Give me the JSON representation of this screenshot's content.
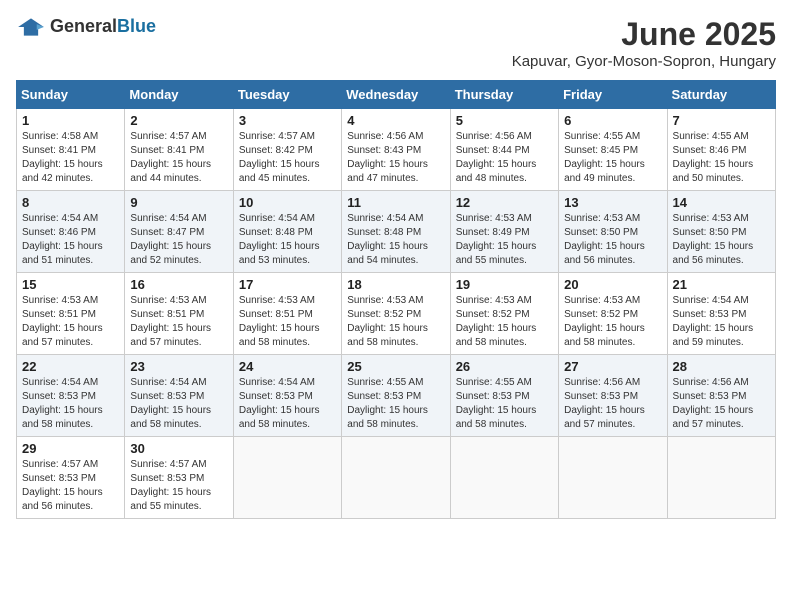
{
  "header": {
    "logo_general": "General",
    "logo_blue": "Blue",
    "month_title": "June 2025",
    "location": "Kapuvar, Gyor-Moson-Sopron, Hungary"
  },
  "days_of_week": [
    "Sunday",
    "Monday",
    "Tuesday",
    "Wednesday",
    "Thursday",
    "Friday",
    "Saturday"
  ],
  "weeks": [
    [
      {
        "day": "1",
        "sunrise": "Sunrise: 4:58 AM",
        "sunset": "Sunset: 8:41 PM",
        "daylight": "Daylight: 15 hours and 42 minutes."
      },
      {
        "day": "2",
        "sunrise": "Sunrise: 4:57 AM",
        "sunset": "Sunset: 8:41 PM",
        "daylight": "Daylight: 15 hours and 44 minutes."
      },
      {
        "day": "3",
        "sunrise": "Sunrise: 4:57 AM",
        "sunset": "Sunset: 8:42 PM",
        "daylight": "Daylight: 15 hours and 45 minutes."
      },
      {
        "day": "4",
        "sunrise": "Sunrise: 4:56 AM",
        "sunset": "Sunset: 8:43 PM",
        "daylight": "Daylight: 15 hours and 47 minutes."
      },
      {
        "day": "5",
        "sunrise": "Sunrise: 4:56 AM",
        "sunset": "Sunset: 8:44 PM",
        "daylight": "Daylight: 15 hours and 48 minutes."
      },
      {
        "day": "6",
        "sunrise": "Sunrise: 4:55 AM",
        "sunset": "Sunset: 8:45 PM",
        "daylight": "Daylight: 15 hours and 49 minutes."
      },
      {
        "day": "7",
        "sunrise": "Sunrise: 4:55 AM",
        "sunset": "Sunset: 8:46 PM",
        "daylight": "Daylight: 15 hours and 50 minutes."
      }
    ],
    [
      {
        "day": "8",
        "sunrise": "Sunrise: 4:54 AM",
        "sunset": "Sunset: 8:46 PM",
        "daylight": "Daylight: 15 hours and 51 minutes."
      },
      {
        "day": "9",
        "sunrise": "Sunrise: 4:54 AM",
        "sunset": "Sunset: 8:47 PM",
        "daylight": "Daylight: 15 hours and 52 minutes."
      },
      {
        "day": "10",
        "sunrise": "Sunrise: 4:54 AM",
        "sunset": "Sunset: 8:48 PM",
        "daylight": "Daylight: 15 hours and 53 minutes."
      },
      {
        "day": "11",
        "sunrise": "Sunrise: 4:54 AM",
        "sunset": "Sunset: 8:48 PM",
        "daylight": "Daylight: 15 hours and 54 minutes."
      },
      {
        "day": "12",
        "sunrise": "Sunrise: 4:53 AM",
        "sunset": "Sunset: 8:49 PM",
        "daylight": "Daylight: 15 hours and 55 minutes."
      },
      {
        "day": "13",
        "sunrise": "Sunrise: 4:53 AM",
        "sunset": "Sunset: 8:50 PM",
        "daylight": "Daylight: 15 hours and 56 minutes."
      },
      {
        "day": "14",
        "sunrise": "Sunrise: 4:53 AM",
        "sunset": "Sunset: 8:50 PM",
        "daylight": "Daylight: 15 hours and 56 minutes."
      }
    ],
    [
      {
        "day": "15",
        "sunrise": "Sunrise: 4:53 AM",
        "sunset": "Sunset: 8:51 PM",
        "daylight": "Daylight: 15 hours and 57 minutes."
      },
      {
        "day": "16",
        "sunrise": "Sunrise: 4:53 AM",
        "sunset": "Sunset: 8:51 PM",
        "daylight": "Daylight: 15 hours and 57 minutes."
      },
      {
        "day": "17",
        "sunrise": "Sunrise: 4:53 AM",
        "sunset": "Sunset: 8:51 PM",
        "daylight": "Daylight: 15 hours and 58 minutes."
      },
      {
        "day": "18",
        "sunrise": "Sunrise: 4:53 AM",
        "sunset": "Sunset: 8:52 PM",
        "daylight": "Daylight: 15 hours and 58 minutes."
      },
      {
        "day": "19",
        "sunrise": "Sunrise: 4:53 AM",
        "sunset": "Sunset: 8:52 PM",
        "daylight": "Daylight: 15 hours and 58 minutes."
      },
      {
        "day": "20",
        "sunrise": "Sunrise: 4:53 AM",
        "sunset": "Sunset: 8:52 PM",
        "daylight": "Daylight: 15 hours and 58 minutes."
      },
      {
        "day": "21",
        "sunrise": "Sunrise: 4:54 AM",
        "sunset": "Sunset: 8:53 PM",
        "daylight": "Daylight: 15 hours and 59 minutes."
      }
    ],
    [
      {
        "day": "22",
        "sunrise": "Sunrise: 4:54 AM",
        "sunset": "Sunset: 8:53 PM",
        "daylight": "Daylight: 15 hours and 58 minutes."
      },
      {
        "day": "23",
        "sunrise": "Sunrise: 4:54 AM",
        "sunset": "Sunset: 8:53 PM",
        "daylight": "Daylight: 15 hours and 58 minutes."
      },
      {
        "day": "24",
        "sunrise": "Sunrise: 4:54 AM",
        "sunset": "Sunset: 8:53 PM",
        "daylight": "Daylight: 15 hours and 58 minutes."
      },
      {
        "day": "25",
        "sunrise": "Sunrise: 4:55 AM",
        "sunset": "Sunset: 8:53 PM",
        "daylight": "Daylight: 15 hours and 58 minutes."
      },
      {
        "day": "26",
        "sunrise": "Sunrise: 4:55 AM",
        "sunset": "Sunset: 8:53 PM",
        "daylight": "Daylight: 15 hours and 58 minutes."
      },
      {
        "day": "27",
        "sunrise": "Sunrise: 4:56 AM",
        "sunset": "Sunset: 8:53 PM",
        "daylight": "Daylight: 15 hours and 57 minutes."
      },
      {
        "day": "28",
        "sunrise": "Sunrise: 4:56 AM",
        "sunset": "Sunset: 8:53 PM",
        "daylight": "Daylight: 15 hours and 57 minutes."
      }
    ],
    [
      {
        "day": "29",
        "sunrise": "Sunrise: 4:57 AM",
        "sunset": "Sunset: 8:53 PM",
        "daylight": "Daylight: 15 hours and 56 minutes."
      },
      {
        "day": "30",
        "sunrise": "Sunrise: 4:57 AM",
        "sunset": "Sunset: 8:53 PM",
        "daylight": "Daylight: 15 hours and 55 minutes."
      },
      null,
      null,
      null,
      null,
      null
    ]
  ]
}
